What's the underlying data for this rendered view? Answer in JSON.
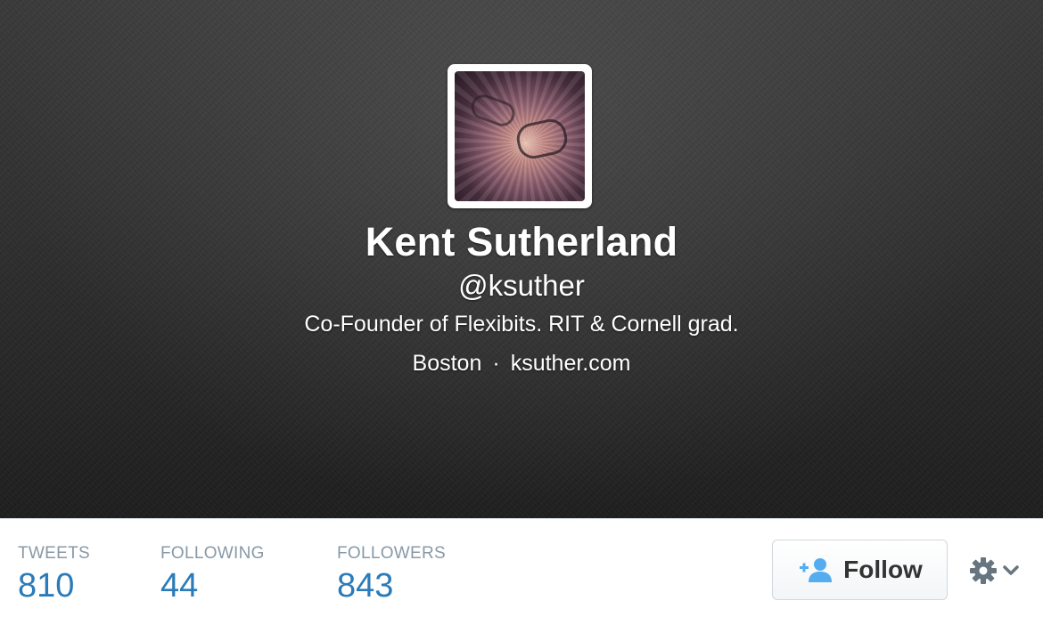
{
  "profile": {
    "name": "Kent Sutherland",
    "handle": "@ksuther",
    "bio": "Co-Founder of Flexibits. RIT & Cornell grad.",
    "location": "Boston",
    "separator": "·",
    "website": "ksuther.com"
  },
  "stats": [
    {
      "label": "TWEETS",
      "value": "810"
    },
    {
      "label": "FOLLOWING",
      "value": "44"
    },
    {
      "label": "FOLLOWERS",
      "value": "843"
    }
  ],
  "actions": {
    "follow_label": "Follow",
    "follow_icon": "add-user-icon",
    "settings_icon": "gear-icon"
  },
  "colors": {
    "accent": "#2b7bb9",
    "label": "#8899a6",
    "follow_icon": "#55acee"
  }
}
